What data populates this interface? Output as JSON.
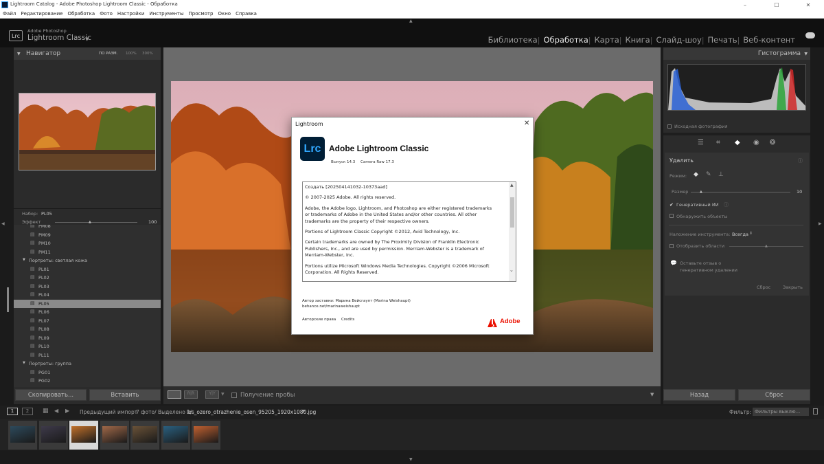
{
  "window": {
    "title": "Lightroom Catalog - Adobe Photoshop Lightroom Classic - Обработка",
    "menu": [
      "Файл",
      "Редактирование",
      "Обработка",
      "Фото",
      "Настройки",
      "Инструменты",
      "Просмотр",
      "Окно",
      "Справка"
    ]
  },
  "identity": {
    "brand": "Adobe Photoshop",
    "product": "Lightroom Classic",
    "logo": "Lrc"
  },
  "modules": [
    "Библиотека",
    "Обработка",
    "Карта",
    "Книга",
    "Слайд-шоу",
    "Печать",
    "Веб-контент"
  ],
  "active_module": "Обработка",
  "navigator": {
    "title": "Навигатор",
    "zoom_options": [
      "ПО РАЗМ.",
      "100%",
      "300%"
    ]
  },
  "presets": {
    "set_label": "Набор:",
    "set_value": "PL05",
    "effect_label": "Эффект",
    "effect_value": "100",
    "items": [
      {
        "label": "PM08"
      },
      {
        "label": "PM09"
      },
      {
        "label": "PM10"
      },
      {
        "label": "PM11"
      },
      {
        "label": "Портреты: светлая кожа",
        "group": true
      },
      {
        "label": "PL01"
      },
      {
        "label": "PL02"
      },
      {
        "label": "PL03"
      },
      {
        "label": "PL04"
      },
      {
        "label": "PL05",
        "selected": true
      },
      {
        "label": "PL06"
      },
      {
        "label": "PL07"
      },
      {
        "label": "PL08"
      },
      {
        "label": "PL09"
      },
      {
        "label": "PL10"
      },
      {
        "label": "PL11"
      },
      {
        "label": "Портреты: группа",
        "group": true
      },
      {
        "label": "PG01"
      },
      {
        "label": "PG02"
      }
    ]
  },
  "left_buttons": {
    "copy": "Скопировать...",
    "paste": "Вставить"
  },
  "toolbar": {
    "proof_label": "Получение пробы"
  },
  "histogram": {
    "title": "Гистограмма",
    "original_label": "Исходная фотография"
  },
  "remove_panel": {
    "title": "Удалить",
    "mode_label": "Режим:",
    "size_label": "Размер",
    "size_value": "10",
    "generative_label": "Генеративный ИИ",
    "generative_checked": true,
    "detect_label": "Обнаружить объекты",
    "overlay_label": "Наложение инструмента:",
    "overlay_value": "Всегда",
    "show_areas_label": "Отобразить области",
    "feedback_label": "Оставьте отзыв о генеративном удалении",
    "reset": "Сброс",
    "close": "Закрыть"
  },
  "right_buttons": {
    "back": "Назад",
    "reset": "Сброс"
  },
  "dialog": {
    "title": "Lightroom",
    "app_name": "Adobe Lightroom Classic",
    "version": "Выпуск 14.3",
    "camera_raw": "Camera Raw 17.3",
    "paragraphs": [
      "Создать [202504141032-10373aad]",
      "© 2007-2025 Adobe. All rights reserved.",
      "Adobe, the Adobe logo, Lightroom, and Photoshop are either registered trademarks or trademarks of Adobe in the United States and/or other countries. All other trademarks are the property of their respective owners.",
      "Portions of Lightroom Classic Copyright ©2012, Avid Technology, Inc.",
      "Certain trademarks are owned by The Proximity Division of Franklin Electronic Publishers, Inc., and are used by permission. Merriam-Webster is a trademark of Merriam-Webster, Inc.",
      "Portions utilize Microsoft Windows Media Technologies. Copyright ©2006 Microsoft Corporation. All Rights Reserved."
    ],
    "credit_author": "Автор заставки: Марина Вейсгаупт (Marina Weishaupt)",
    "credit_url": "behance.net/marinaweishaupt",
    "link_rights": "Авторские права",
    "link_credits": "Credits",
    "adobe": "Adobe"
  },
  "filmstrip": {
    "source": "Предыдущий импорт",
    "count": "7 фото/ Выделено 1/",
    "filename": "les_ozero_otrazhenie_osen_95205_1920x1080.jpg",
    "filter_label": "Фильтр:",
    "filter_value": "Фильтры выклю...",
    "page1": "1",
    "page2": "2",
    "thumbs": [
      {
        "name": "portrait-woman",
        "color": "#2d4a5c"
      },
      {
        "name": "dark-forest",
        "color": "#3e3a4a"
      },
      {
        "name": "autumn-lake",
        "color": "#c0702a"
      },
      {
        "name": "portrait-smile",
        "color": "#a06848"
      },
      {
        "name": "owl",
        "color": "#6a5238"
      },
      {
        "name": "mountain-lake",
        "color": "#2a6080"
      },
      {
        "name": "sunset-sea",
        "color": "#c06030"
      }
    ]
  }
}
